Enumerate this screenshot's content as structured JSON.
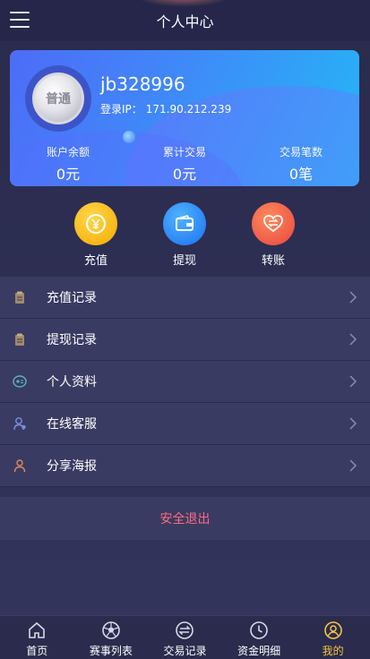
{
  "header": {
    "title": "个人中心",
    "menu_icon": "hamburger-menu-icon"
  },
  "profile": {
    "badge_text": "普通",
    "username": "jb328996",
    "login_ip_label": "登录IP：",
    "login_ip": "171.90.212.239",
    "stats": [
      {
        "label": "账户余额",
        "value": "0元"
      },
      {
        "label": "累计交易",
        "value": "0元"
      },
      {
        "label": "交易笔数",
        "value": "0笔"
      }
    ]
  },
  "actions": [
    {
      "label": "充值",
      "icon": "yuan-coin-icon",
      "color": "#f6b400"
    },
    {
      "label": "提现",
      "icon": "wallet-icon",
      "color": "#2d8ef5"
    },
    {
      "label": "转账",
      "icon": "heart-transfer-icon",
      "color": "#f15b45"
    }
  ],
  "menu": [
    {
      "label": "充值记录",
      "icon": "clipboard-icon"
    },
    {
      "label": "提现记录",
      "icon": "clipboard-icon"
    },
    {
      "label": "个人资料",
      "icon": "profile-card-icon"
    },
    {
      "label": "在线客服",
      "icon": "customer-service-icon"
    },
    {
      "label": "分享海报",
      "icon": "share-person-icon"
    }
  ],
  "logout_label": "安全退出",
  "colors": {
    "accent": "#f5c342",
    "logout": "#ff6b81",
    "background": "#2e2f55"
  },
  "tabbar": [
    {
      "label": "首页",
      "icon": "home-icon",
      "active": false
    },
    {
      "label": "赛事列表",
      "icon": "soccer-ball-icon",
      "active": false
    },
    {
      "label": "交易记录",
      "icon": "exchange-icon",
      "active": false
    },
    {
      "label": "资金明细",
      "icon": "clock-icon",
      "active": false
    },
    {
      "label": "我的",
      "icon": "user-icon",
      "active": true
    }
  ]
}
